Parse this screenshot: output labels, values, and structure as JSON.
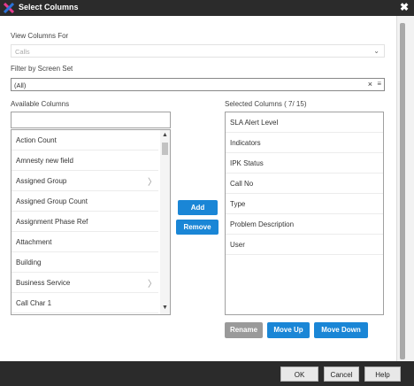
{
  "window": {
    "title": "Select Columns",
    "logo_icon": "x-logo-icon",
    "close_symbol": "✖"
  },
  "view_columns": {
    "label": "View Columns For",
    "value": "Calls",
    "chevron": "⌄"
  },
  "screen_set": {
    "label": "Filter by Screen Set",
    "value": "(All)",
    "clear_symbol": "×",
    "menu_symbol": "≡"
  },
  "available": {
    "label": "Available Columns",
    "search_value": "",
    "items": [
      {
        "label": "Action Count",
        "has_sub": false
      },
      {
        "label": "Amnesty new field",
        "has_sub": false
      },
      {
        "label": "Assigned Group",
        "has_sub": true
      },
      {
        "label": "Assigned Group Count",
        "has_sub": false
      },
      {
        "label": "Assignment Phase Ref",
        "has_sub": false
      },
      {
        "label": "Attachment",
        "has_sub": false
      },
      {
        "label": "Building",
        "has_sub": false
      },
      {
        "label": "Business Service",
        "has_sub": true
      },
      {
        "label": "Call Char 1",
        "has_sub": false
      }
    ],
    "submenu_arrow": "〉",
    "scroll_up": "▲",
    "scroll_down": "▼"
  },
  "actions": {
    "add_label": "Add",
    "remove_label": "Remove"
  },
  "selected": {
    "label": "Selected Columns ( 7/ 15)",
    "items": [
      "SLA Alert Level",
      "Indicators",
      "IPK Status",
      "Call No",
      "Type",
      "Problem Description",
      "User"
    ]
  },
  "reorder": {
    "rename_label": "Rename",
    "move_up_label": "Move Up",
    "move_down_label": "Move Down"
  },
  "footer": {
    "ok_label": "OK",
    "cancel_label": "Cancel",
    "help_label": "Help"
  },
  "colors": {
    "accent_blue": "#1a86d6",
    "title_bar": "#2b2b2b",
    "disabled_button": "#9a9a9a",
    "logo_colors": [
      "#e63a8f",
      "#2a73d9"
    ]
  }
}
